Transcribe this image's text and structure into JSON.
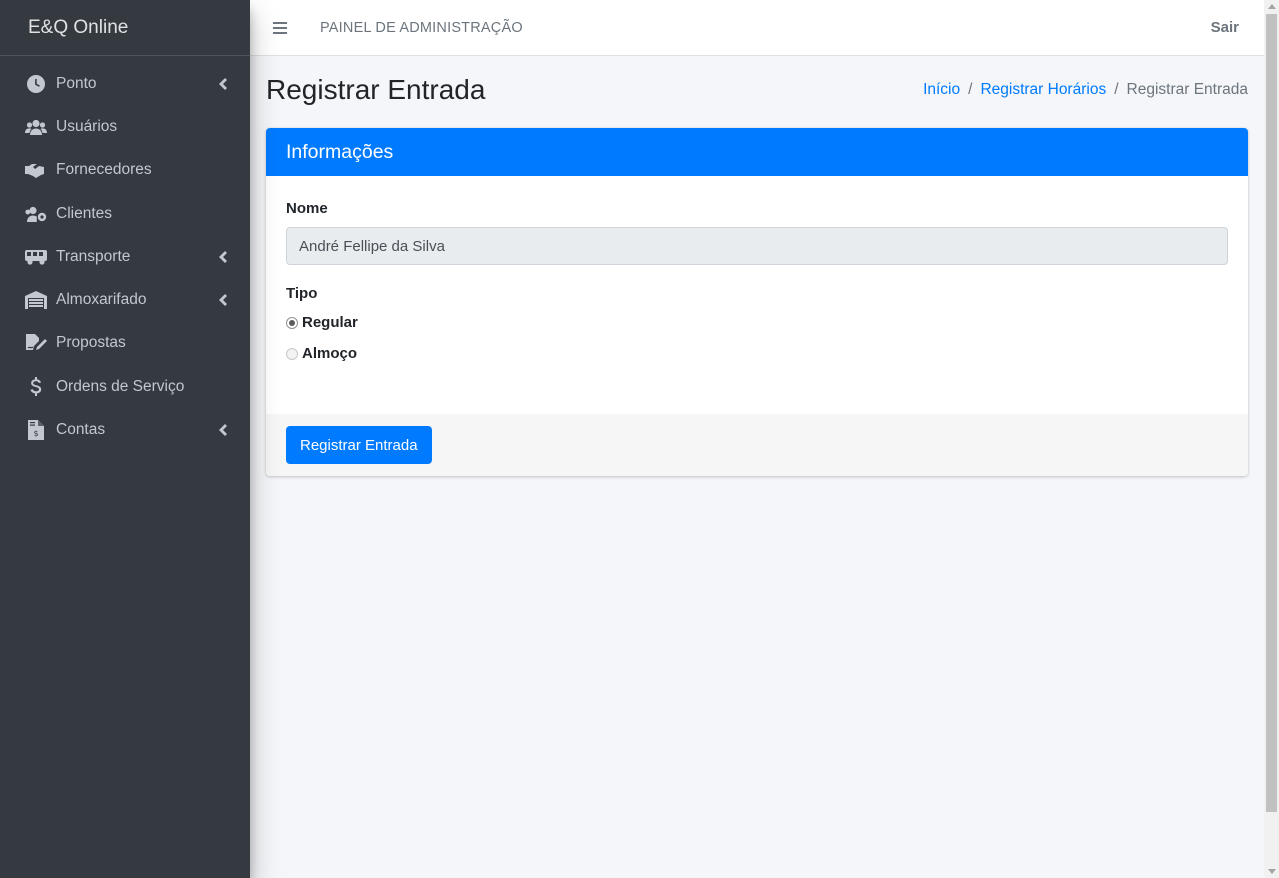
{
  "brand": {
    "title": "E&Q Online"
  },
  "sidebar": {
    "items": [
      {
        "label": "Ponto",
        "icon": "clock-icon",
        "has_submenu": true
      },
      {
        "label": "Usuários",
        "icon": "users-icon",
        "has_submenu": false
      },
      {
        "label": "Fornecedores",
        "icon": "handshake-icon",
        "has_submenu": false
      },
      {
        "label": "Clientes",
        "icon": "users-cog-icon",
        "has_submenu": false
      },
      {
        "label": "Transporte",
        "icon": "bus-icon",
        "has_submenu": true
      },
      {
        "label": "Almoxarifado",
        "icon": "warehouse-icon",
        "has_submenu": true
      },
      {
        "label": "Propostas",
        "icon": "file-signature-icon",
        "has_submenu": false
      },
      {
        "label": "Ordens de Serviço",
        "icon": "dollar-sign-icon",
        "has_submenu": false
      },
      {
        "label": "Contas",
        "icon": "file-invoice-dollar-icon",
        "has_submenu": true
      }
    ]
  },
  "topbar": {
    "title": "PAINEL DE ADMINISTRAÇÃO",
    "logout_label": "Sair"
  },
  "page": {
    "title": "Registrar Entrada",
    "breadcrumb": [
      "Início",
      "Registrar Horários",
      "Registrar Entrada"
    ]
  },
  "card": {
    "header": "Informações",
    "name_label": "Nome",
    "name_value": "André Fellipe da Silva",
    "type_label": "Tipo",
    "options": [
      {
        "label": "Regular",
        "checked": true
      },
      {
        "label": "Almoço",
        "checked": false
      }
    ],
    "submit_label": "Registrar Entrada"
  },
  "colors": {
    "sidebar_bg": "#343a40",
    "primary": "#007bff",
    "content_bg": "#f4f6f9"
  }
}
